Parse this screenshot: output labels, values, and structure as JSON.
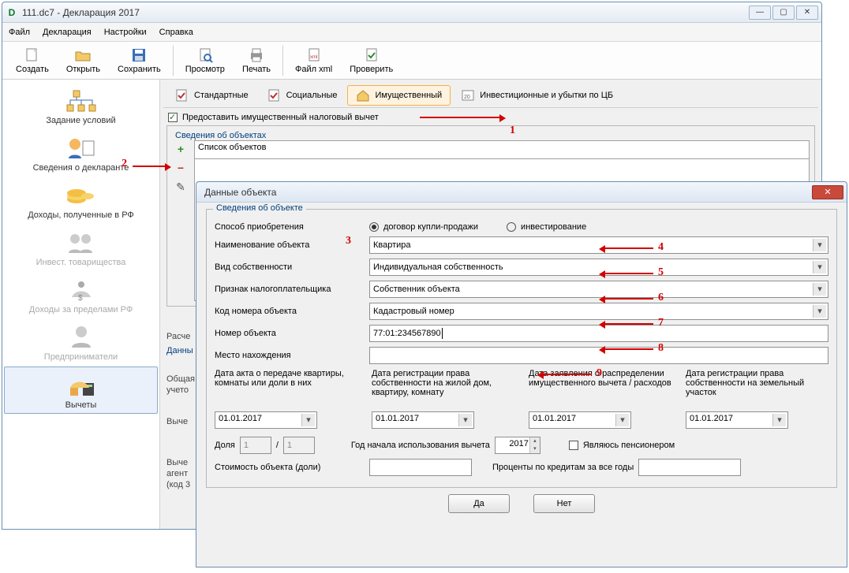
{
  "window": {
    "title": "111.dc7 - Декларация 2017"
  },
  "menu": {
    "file": "Файл",
    "decl": "Декларация",
    "settings": "Настройки",
    "help": "Справка"
  },
  "toolbar": {
    "new": "Создать",
    "open": "Открыть",
    "save": "Сохранить",
    "preview": "Просмотр",
    "print": "Печать",
    "xml": "Файл xml",
    "check": "Проверить"
  },
  "sidebar": {
    "items": [
      {
        "label": "Задание условий"
      },
      {
        "label": "Сведения о декларанте"
      },
      {
        "label": "Доходы, полученные в РФ"
      },
      {
        "label": "Инвест. товарищества"
      },
      {
        "label": "Доходы за пределами РФ"
      },
      {
        "label": "Предприниматели"
      },
      {
        "label": "Вычеты"
      }
    ]
  },
  "tabs": {
    "standard": "Стандартные",
    "social": "Социальные",
    "property": "Имущественный",
    "invest": "Инвестиционные и убытки по ЦБ"
  },
  "content": {
    "provide_checkbox": "Предоставить имущественный налоговый вычет",
    "objects_legend": "Сведения об объектах",
    "list_header": "Список объектов",
    "calc_legend": "Расче",
    "calc_sub": "Данны",
    "calc_1": "Общая",
    "calc_2": "учето",
    "calc_3": "Выче",
    "calc_4": "Выче",
    "calc_5": "агент",
    "calc_6": "(код 3"
  },
  "dialog": {
    "title": "Данные объекта",
    "fs_legend": "Сведения об объекте",
    "acq_label": "Способ приобретения",
    "radio_buy": "договор купли-продажи",
    "radio_invest": "инвестирование",
    "name_label": "Наименование объекта",
    "name_value": "Квартира",
    "own_label": "Вид собственности",
    "own_value": "Индивидуальная собственность",
    "taxpayer_label": "Признак налогоплательщика",
    "taxpayer_value": "Собственник объекта",
    "codenum_label": "Код номера объекта",
    "codenum_value": "Кадастровый номер",
    "num_label": "Номер объекта",
    "num_value": "77:01:234567890",
    "loc_label": "Место нахождения",
    "loc_value": "",
    "date1_label": "Дата акта о передаче квартиры, комнаты или доли в них",
    "date2_label": "Дата регистрации права собственности на жилой дом, квартиру, комнату",
    "date3_label": "Дата заявления о распределении имущественного вычета / расходов",
    "date4_label": "Дата регистрации права собственности на земельный участок",
    "date_value": "01.01.2017",
    "share_label": "Доля",
    "share_a": "1",
    "share_b": "1",
    "year_label": "Год начала использования вычета",
    "year_value": "2017",
    "pension_label": "Являюсь пенсионером",
    "cost_label": "Стоимость объекта (доли)",
    "percent_label": "Проценты по кредитам за все годы",
    "ok": "Да",
    "cancel": "Нет"
  },
  "nums": {
    "n1": "1",
    "n2": "2",
    "n3": "3",
    "n4": "4",
    "n5": "5",
    "n6": "6",
    "n7": "7",
    "n8": "8",
    "n9": "9"
  }
}
